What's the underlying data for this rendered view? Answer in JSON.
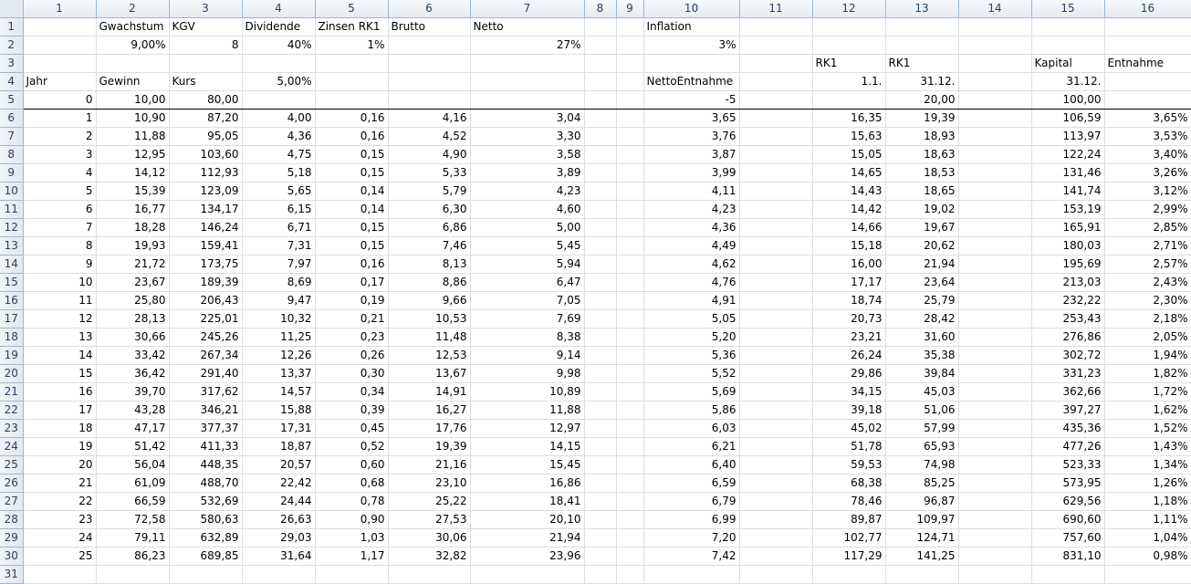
{
  "columns": [
    "1",
    "2",
    "3",
    "4",
    "5",
    "6",
    "7",
    "8",
    "9",
    "10",
    "11",
    "12",
    "13",
    "14",
    "15",
    "16"
  ],
  "rows": [
    {
      "n": "1",
      "c": [
        "",
        "Gwachstum",
        "KGV",
        "Dividende",
        "Zinsen RK1",
        "Brutto",
        "Netto",
        "",
        "",
        "Inflation",
        "",
        "",
        "",
        "",
        "",
        ""
      ]
    },
    {
      "n": "2",
      "c": [
        "",
        "9,00%",
        "8",
        "40%",
        "1%",
        "",
        "27%",
        "",
        "",
        "3%",
        "",
        "",
        "",
        "",
        "",
        ""
      ]
    },
    {
      "n": "3",
      "c": [
        "",
        "",
        "",
        "",
        "",
        "",
        "",
        "",
        "",
        "",
        "",
        "RK1",
        "RK1",
        "",
        "Kapital",
        "Entnahme"
      ]
    },
    {
      "n": "4",
      "c": [
        "Jahr",
        "Gewinn",
        "Kurs",
        "5,00%",
        "",
        "",
        "",
        "",
        "",
        "NettoEntnahme",
        "",
        "1.1.",
        "31.12.",
        "",
        "31.12.",
        ""
      ]
    },
    {
      "n": "5",
      "c": [
        "0",
        "10,00",
        "80,00",
        "",
        "",
        "",
        "",
        "",
        "",
        "-5",
        "",
        "",
        "20,00",
        "",
        "100,00",
        ""
      ]
    },
    {
      "n": "6",
      "c": [
        "1",
        "10,90",
        "87,20",
        "4,00",
        "0,16",
        "4,16",
        "3,04",
        "",
        "",
        "3,65",
        "",
        "16,35",
        "19,39",
        "",
        "106,59",
        "3,65%"
      ]
    },
    {
      "n": "7",
      "c": [
        "2",
        "11,88",
        "95,05",
        "4,36",
        "0,16",
        "4,52",
        "3,30",
        "",
        "",
        "3,76",
        "",
        "15,63",
        "18,93",
        "",
        "113,97",
        "3,53%"
      ]
    },
    {
      "n": "8",
      "c": [
        "3",
        "12,95",
        "103,60",
        "4,75",
        "0,15",
        "4,90",
        "3,58",
        "",
        "",
        "3,87",
        "",
        "15,05",
        "18,63",
        "",
        "122,24",
        "3,40%"
      ]
    },
    {
      "n": "9",
      "c": [
        "4",
        "14,12",
        "112,93",
        "5,18",
        "0,15",
        "5,33",
        "3,89",
        "",
        "",
        "3,99",
        "",
        "14,65",
        "18,53",
        "",
        "131,46",
        "3,26%"
      ]
    },
    {
      "n": "10",
      "c": [
        "5",
        "15,39",
        "123,09",
        "5,65",
        "0,14",
        "5,79",
        "4,23",
        "",
        "",
        "4,11",
        "",
        "14,43",
        "18,65",
        "",
        "141,74",
        "3,12%"
      ]
    },
    {
      "n": "11",
      "c": [
        "6",
        "16,77",
        "134,17",
        "6,15",
        "0,14",
        "6,30",
        "4,60",
        "",
        "",
        "4,23",
        "",
        "14,42",
        "19,02",
        "",
        "153,19",
        "2,99%"
      ]
    },
    {
      "n": "12",
      "c": [
        "7",
        "18,28",
        "146,24",
        "6,71",
        "0,15",
        "6,86",
        "5,00",
        "",
        "",
        "4,36",
        "",
        "14,66",
        "19,67",
        "",
        "165,91",
        "2,85%"
      ]
    },
    {
      "n": "13",
      "c": [
        "8",
        "19,93",
        "159,41",
        "7,31",
        "0,15",
        "7,46",
        "5,45",
        "",
        "",
        "4,49",
        "",
        "15,18",
        "20,62",
        "",
        "180,03",
        "2,71%"
      ]
    },
    {
      "n": "14",
      "c": [
        "9",
        "21,72",
        "173,75",
        "7,97",
        "0,16",
        "8,13",
        "5,94",
        "",
        "",
        "4,62",
        "",
        "16,00",
        "21,94",
        "",
        "195,69",
        "2,57%"
      ]
    },
    {
      "n": "15",
      "c": [
        "10",
        "23,67",
        "189,39",
        "8,69",
        "0,17",
        "8,86",
        "6,47",
        "",
        "",
        "4,76",
        "",
        "17,17",
        "23,64",
        "",
        "213,03",
        "2,43%"
      ]
    },
    {
      "n": "16",
      "c": [
        "11",
        "25,80",
        "206,43",
        "9,47",
        "0,19",
        "9,66",
        "7,05",
        "",
        "",
        "4,91",
        "",
        "18,74",
        "25,79",
        "",
        "232,22",
        "2,30%"
      ]
    },
    {
      "n": "17",
      "c": [
        "12",
        "28,13",
        "225,01",
        "10,32",
        "0,21",
        "10,53",
        "7,69",
        "",
        "",
        "5,05",
        "",
        "20,73",
        "28,42",
        "",
        "253,43",
        "2,18%"
      ]
    },
    {
      "n": "18",
      "c": [
        "13",
        "30,66",
        "245,26",
        "11,25",
        "0,23",
        "11,48",
        "8,38",
        "",
        "",
        "5,20",
        "",
        "23,21",
        "31,60",
        "",
        "276,86",
        "2,05%"
      ]
    },
    {
      "n": "19",
      "c": [
        "14",
        "33,42",
        "267,34",
        "12,26",
        "0,26",
        "12,53",
        "9,14",
        "",
        "",
        "5,36",
        "",
        "26,24",
        "35,38",
        "",
        "302,72",
        "1,94%"
      ]
    },
    {
      "n": "20",
      "c": [
        "15",
        "36,42",
        "291,40",
        "13,37",
        "0,30",
        "13,67",
        "9,98",
        "",
        "",
        "5,52",
        "",
        "29,86",
        "39,84",
        "",
        "331,23",
        "1,82%"
      ]
    },
    {
      "n": "21",
      "c": [
        "16",
        "39,70",
        "317,62",
        "14,57",
        "0,34",
        "14,91",
        "10,89",
        "",
        "",
        "5,69",
        "",
        "34,15",
        "45,03",
        "",
        "362,66",
        "1,72%"
      ]
    },
    {
      "n": "22",
      "c": [
        "17",
        "43,28",
        "346,21",
        "15,88",
        "0,39",
        "16,27",
        "11,88",
        "",
        "",
        "5,86",
        "",
        "39,18",
        "51,06",
        "",
        "397,27",
        "1,62%"
      ]
    },
    {
      "n": "23",
      "c": [
        "18",
        "47,17",
        "377,37",
        "17,31",
        "0,45",
        "17,76",
        "12,97",
        "",
        "",
        "6,03",
        "",
        "45,02",
        "57,99",
        "",
        "435,36",
        "1,52%"
      ]
    },
    {
      "n": "24",
      "c": [
        "19",
        "51,42",
        "411,33",
        "18,87",
        "0,52",
        "19,39",
        "14,15",
        "",
        "",
        "6,21",
        "",
        "51,78",
        "65,93",
        "",
        "477,26",
        "1,43%"
      ]
    },
    {
      "n": "25",
      "c": [
        "20",
        "56,04",
        "448,35",
        "20,57",
        "0,60",
        "21,16",
        "15,45",
        "",
        "",
        "6,40",
        "",
        "59,53",
        "74,98",
        "",
        "523,33",
        "1,34%"
      ]
    },
    {
      "n": "26",
      "c": [
        "21",
        "61,09",
        "488,70",
        "22,42",
        "0,68",
        "23,10",
        "16,86",
        "",
        "",
        "6,59",
        "",
        "68,38",
        "85,25",
        "",
        "573,95",
        "1,26%"
      ]
    },
    {
      "n": "27",
      "c": [
        "22",
        "66,59",
        "532,69",
        "24,44",
        "0,78",
        "25,22",
        "18,41",
        "",
        "",
        "6,79",
        "",
        "78,46",
        "96,87",
        "",
        "629,56",
        "1,18%"
      ]
    },
    {
      "n": "28",
      "c": [
        "23",
        "72,58",
        "580,63",
        "26,63",
        "0,90",
        "27,53",
        "20,10",
        "",
        "",
        "6,99",
        "",
        "89,87",
        "109,97",
        "",
        "690,60",
        "1,11%"
      ]
    },
    {
      "n": "29",
      "c": [
        "24",
        "79,11",
        "632,89",
        "29,03",
        "1,03",
        "30,06",
        "21,94",
        "",
        "",
        "7,20",
        "",
        "102,77",
        "124,71",
        "",
        "757,60",
        "1,04%"
      ]
    },
    {
      "n": "30",
      "c": [
        "25",
        "86,23",
        "689,85",
        "31,64",
        "1,17",
        "32,82",
        "23,96",
        "",
        "",
        "7,42",
        "",
        "117,29",
        "141,25",
        "",
        "831,10",
        "0,98%"
      ]
    },
    {
      "n": "31",
      "c": [
        "",
        "",
        "",
        "",
        "",
        "",
        "",
        "",
        "",
        "",
        "",
        "",
        "",
        "",
        "",
        ""
      ]
    }
  ]
}
